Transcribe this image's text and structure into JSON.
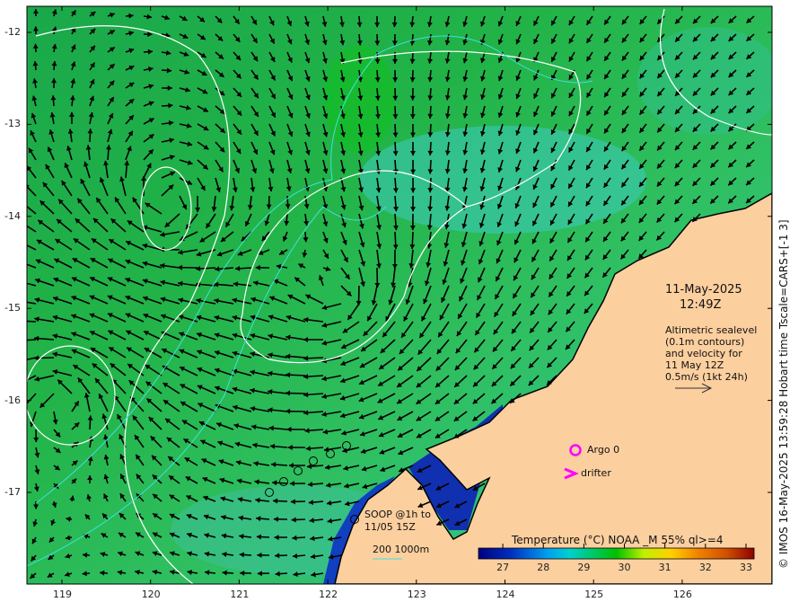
{
  "map": {
    "date": "11-May-2025",
    "time": "12:49Z",
    "legend_note": [
      "Altimetric sealevel",
      "(0.1m contours)",
      "and velocity for",
      "11 May 12Z",
      "0.5m/s (1kt 24h)"
    ],
    "argo_label": "Argo 0",
    "drifter_label": "drifter",
    "soop_label": [
      "SOOP @1h to",
      "11/05 15Z"
    ],
    "isobath_label": "200  1000m",
    "credit": "© IMOS 16-May-2025 13:59:28 Hobart time Tscale=CARS+[-1 3]",
    "x_ticks": [
      "119",
      "120",
      "121",
      "122",
      "123",
      "124",
      "125",
      "126"
    ],
    "y_ticks": [
      "-12",
      "-13",
      "-14",
      "-15",
      "-16",
      "-17"
    ],
    "colors": {
      "land": "#fccf9f",
      "ocean": "#22b04a",
      "argo": "#ff00ff",
      "drifter": "#ff00ff",
      "contour": "#ffffff",
      "isobath": "#40e0e0"
    }
  },
  "colorbar": {
    "title": "Temperature (°C) NOAA _M 55% ql>=4",
    "ticks": [
      "27",
      "28",
      "29",
      "30",
      "31",
      "32",
      "33"
    ],
    "range": [
      26.4,
      33.2
    ]
  }
}
